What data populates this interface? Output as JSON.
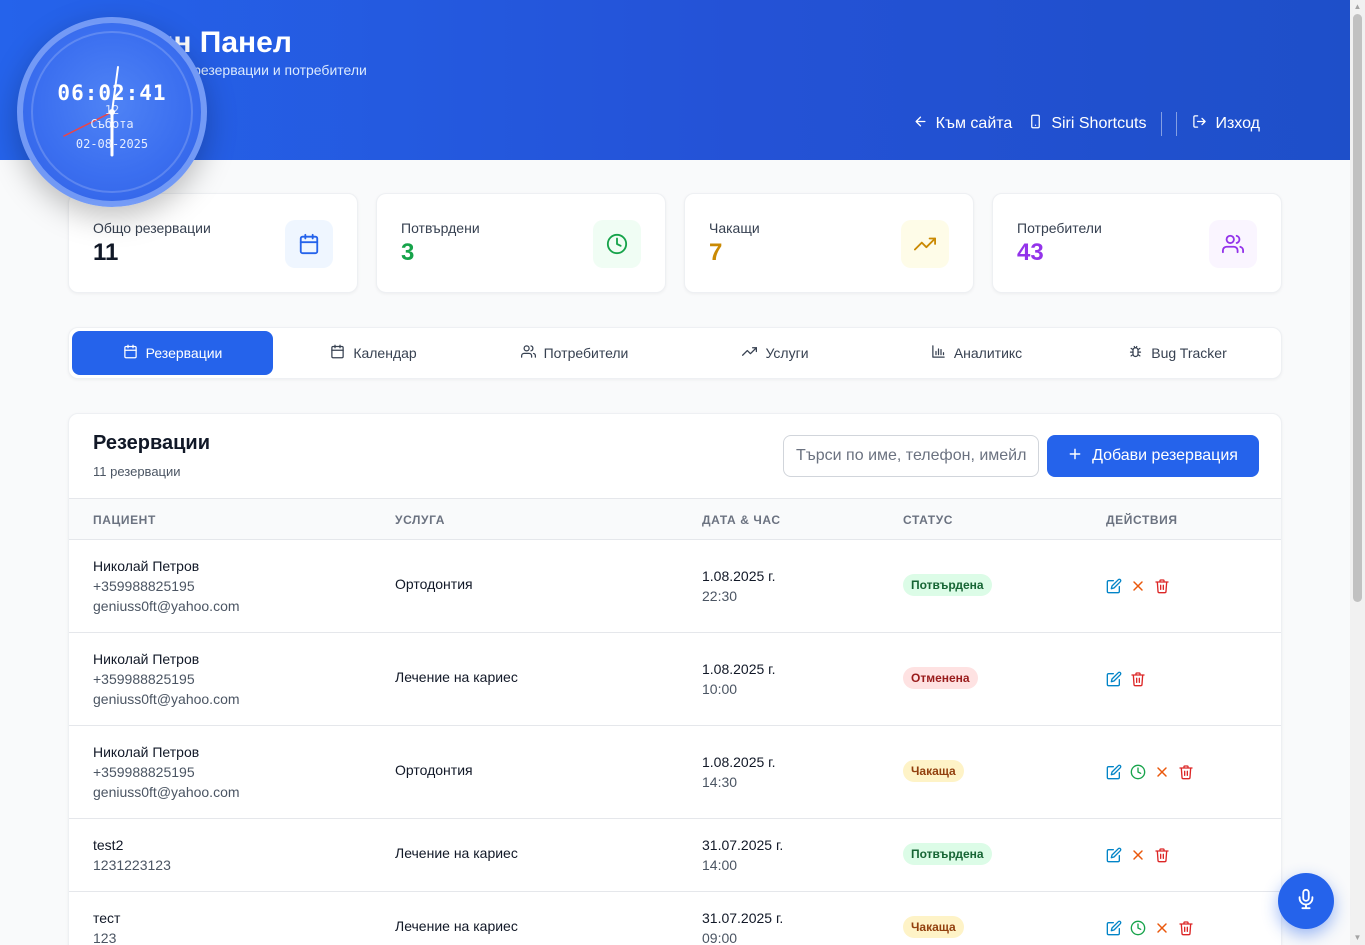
{
  "header": {
    "title": "Админ Панел",
    "subtitle": "Управление на резервации и потребители",
    "nav": {
      "back_label": "Към сайта",
      "siri_label": "Siri Shortcuts",
      "logout_label": "Изход"
    }
  },
  "clock": {
    "time": "06:02:41",
    "numeral": "12",
    "day": "Събота",
    "date": "02-08-2025"
  },
  "stats": [
    {
      "label": "Общо резервации",
      "value": "11",
      "color": "#111827",
      "icon": "calendar-icon",
      "icon_bg": "#eff6ff",
      "icon_color": "#2563eb"
    },
    {
      "label": "Потвърдени",
      "value": "3",
      "color": "#16a34a",
      "icon": "clock-icon",
      "icon_bg": "#f0fdf4",
      "icon_color": "#16a34a"
    },
    {
      "label": "Чакащи",
      "value": "7",
      "color": "#ca8a04",
      "icon": "trending-up-icon",
      "icon_bg": "#fefce8",
      "icon_color": "#ca8a04"
    },
    {
      "label": "Потребители",
      "value": "43",
      "color": "#9333ea",
      "icon": "users-icon",
      "icon_bg": "#faf5ff",
      "icon_color": "#9333ea"
    }
  ],
  "tabs": [
    {
      "label": "Резервации",
      "icon": "calendar-icon",
      "active": true
    },
    {
      "label": "Календар",
      "icon": "calendar-icon",
      "active": false
    },
    {
      "label": "Потребители",
      "icon": "users-icon",
      "active": false
    },
    {
      "label": "Услуги",
      "icon": "trending-up-icon",
      "active": false
    },
    {
      "label": "Аналитикс",
      "icon": "bar-chart-icon",
      "active": false
    },
    {
      "label": "Bug Tracker",
      "icon": "bug-icon",
      "active": false
    }
  ],
  "reservations": {
    "title": "Резервации",
    "count_label": "11 резервации",
    "search_placeholder": "Търси по име, телефон, имейл...",
    "add_label": "Добави резервация",
    "columns": [
      "ПАЦИЕНТ",
      "УСЛУГА",
      "ДАТА & ЧАС",
      "СТАТУС",
      "ДЕЙСТВИЯ"
    ],
    "rows": [
      {
        "name": "Николай Петров",
        "phone": "+359988825195",
        "email": "geniuss0ft@yahoo.com",
        "service": "Ортодонтия",
        "date": "1.08.2025 г.",
        "time": "22:30",
        "status": "Потвърдена",
        "status_kind": "confirmed",
        "actions": [
          "edit",
          "cancel",
          "delete"
        ]
      },
      {
        "name": "Николай Петров",
        "phone": "+359988825195",
        "email": "geniuss0ft@yahoo.com",
        "service": "Лечение на кариес",
        "date": "1.08.2025 г.",
        "time": "10:00",
        "status": "Отменена",
        "status_kind": "cancelled",
        "actions": [
          "edit",
          "delete"
        ]
      },
      {
        "name": "Николай Петров",
        "phone": "+359988825195",
        "email": "geniuss0ft@yahoo.com",
        "service": "Ортодонтия",
        "date": "1.08.2025 г.",
        "time": "14:30",
        "status": "Чакаща",
        "status_kind": "pending",
        "actions": [
          "edit",
          "confirm",
          "cancel",
          "delete"
        ]
      },
      {
        "name": "test2",
        "phone": "1231223123",
        "email": "",
        "service": "Лечение на кариес",
        "date": "31.07.2025 г.",
        "time": "14:00",
        "status": "Потвърдена",
        "status_kind": "confirmed",
        "actions": [
          "edit",
          "cancel",
          "delete"
        ]
      },
      {
        "name": "тест",
        "phone": "123",
        "email": "",
        "service": "Лечение на кариес",
        "date": "31.07.2025 г.",
        "time": "09:00",
        "status": "Чакаща",
        "status_kind": "pending",
        "actions": [
          "edit",
          "confirm",
          "cancel",
          "delete"
        ]
      }
    ]
  },
  "colors": {
    "primary": "#2563eb",
    "edit": "#0284c7",
    "confirm": "#16a34a",
    "cancel": "#ea580c",
    "delete": "#dc2626"
  },
  "mic_icon": "microphone-icon"
}
